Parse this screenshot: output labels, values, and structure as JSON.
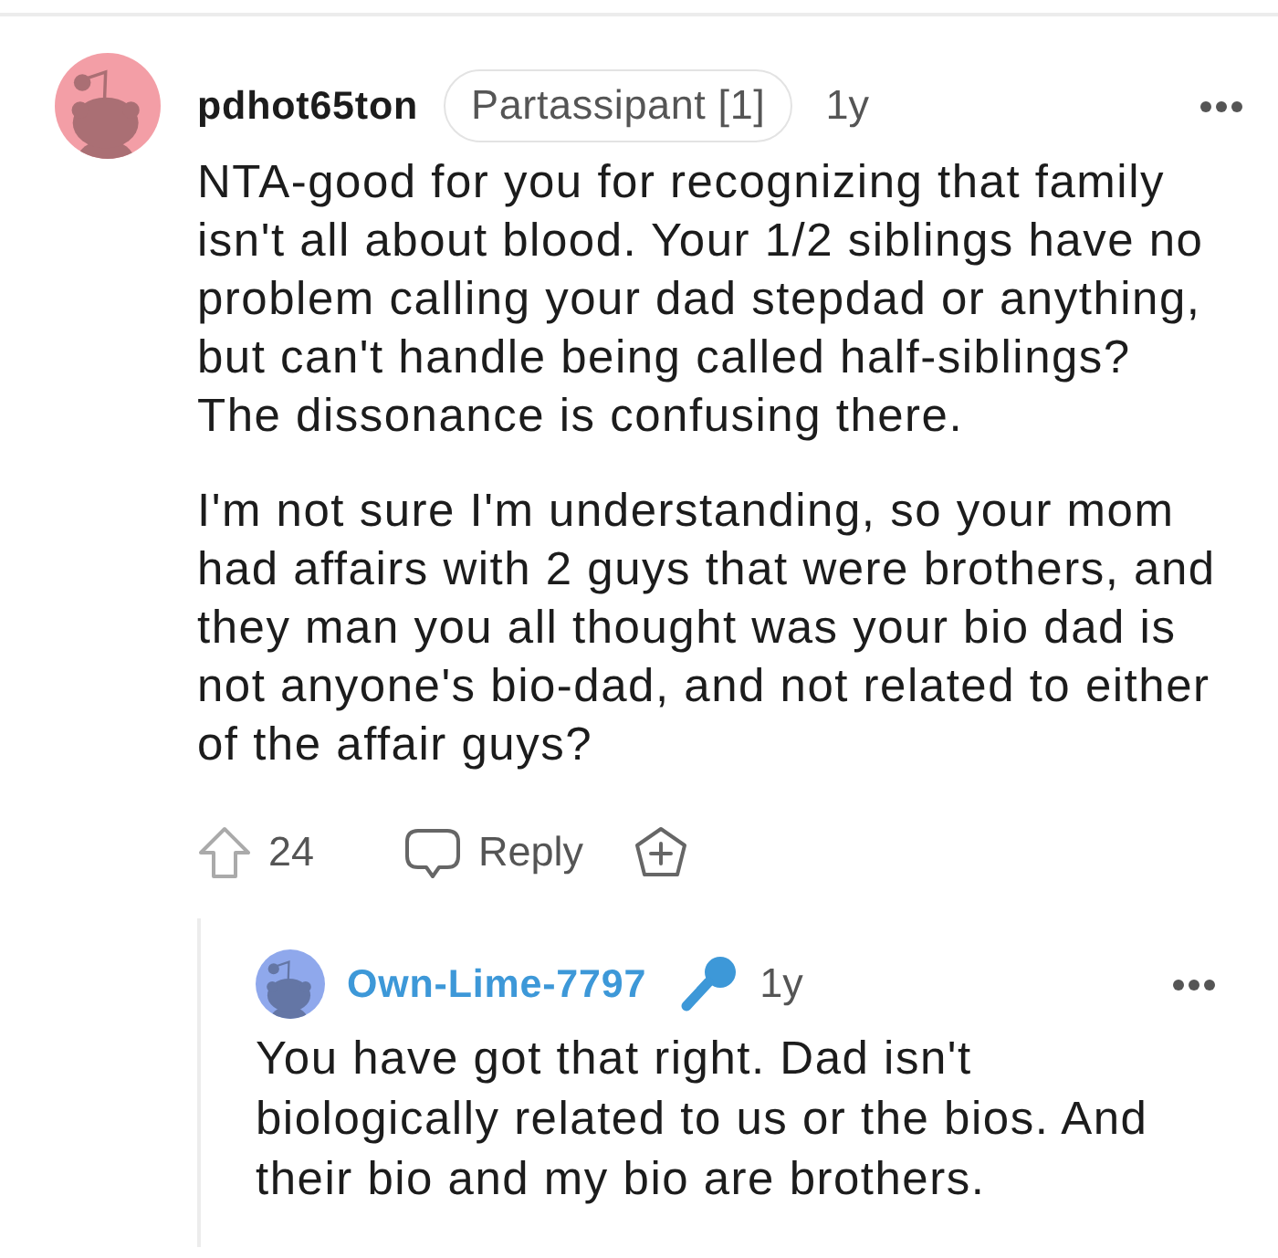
{
  "comments": [
    {
      "author": "pdhot65ton",
      "color": "#f39ea6",
      "op": false,
      "flair": "Partassipant [1]",
      "age": "1y",
      "paragraphs": [
        "NTA-good for you for recognizing that family isn't all about blood. Your 1/2 siblings have no problem calling your dad stepdad or anything, but can't handle being called half-siblings? The dissonance is confusing there.",
        "I'm not sure I'm understanding, so your mom had affairs with 2 guys that were brothers, and they man you all thought was your bio dad is not anyone's bio-dad, and not related to either of the affair guys?"
      ],
      "actions": {
        "votes": "24",
        "reply": "Reply"
      },
      "children": [
        {
          "author": "Own-Lime-7797",
          "color": "#8fa8ec",
          "op": true,
          "age": "1y",
          "paragraphs": [
            "You have got that right. Dad isn't biologically related to us or the bios. And their bio and my bio are brothers."
          ]
        }
      ]
    }
  ]
}
